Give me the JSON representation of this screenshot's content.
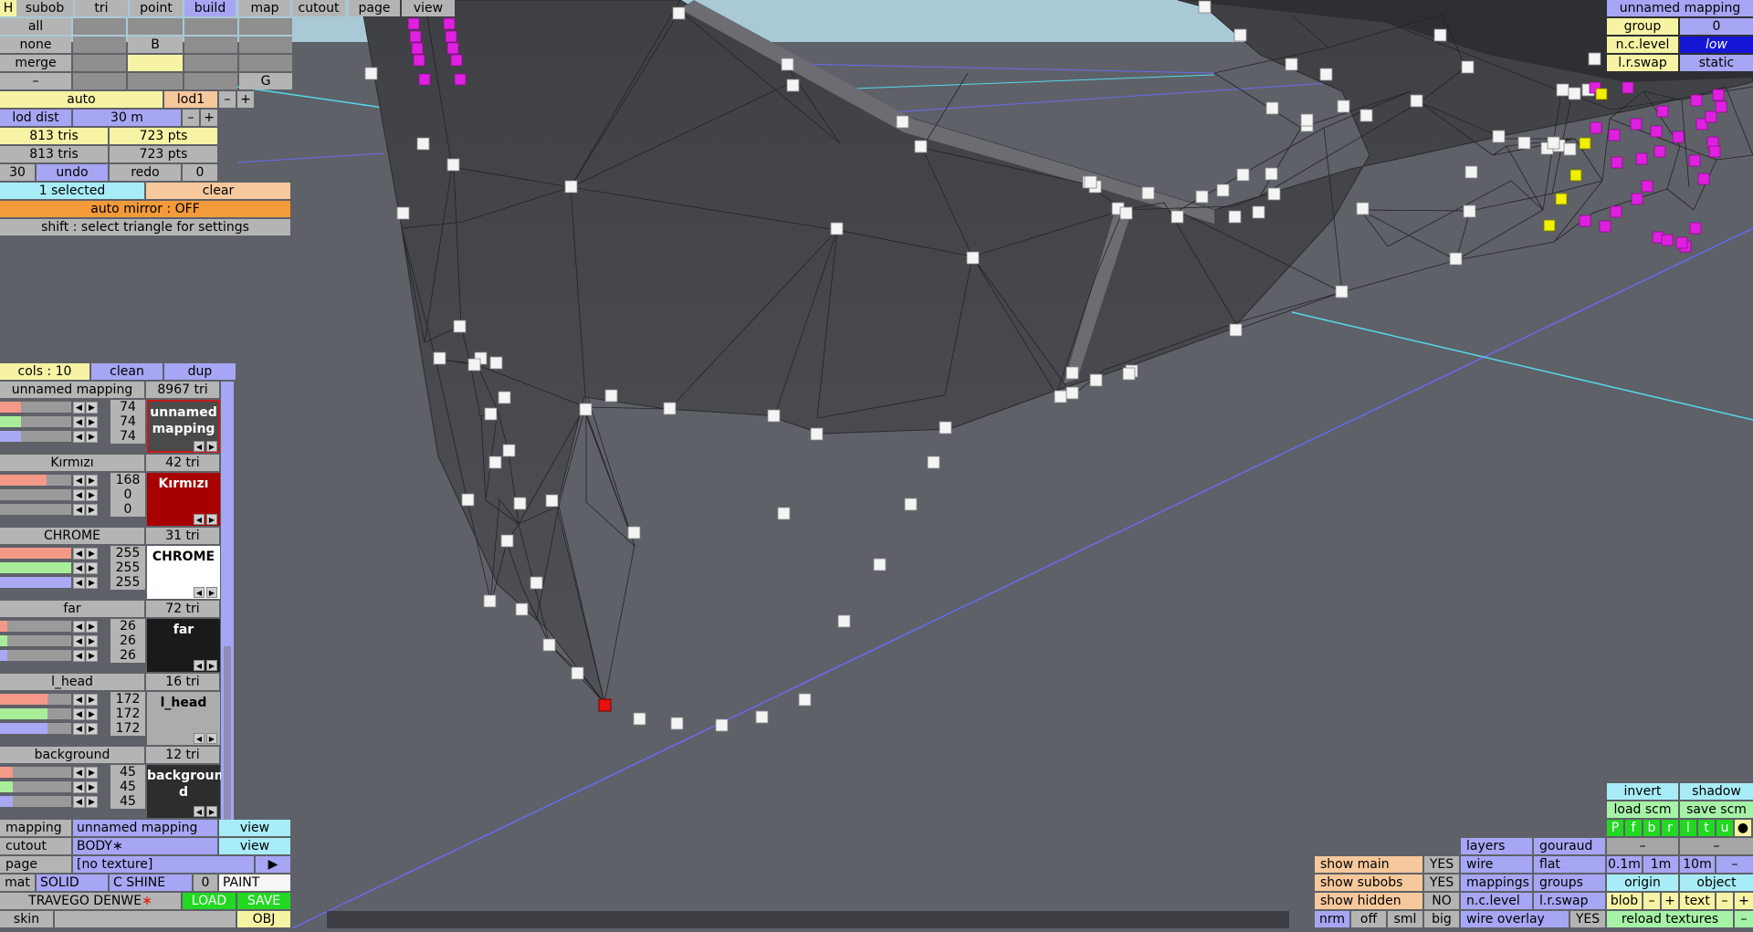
{
  "top_tabs": {
    "h": "H",
    "subob": "subob",
    "tri": "tri",
    "point": "point",
    "build": "build",
    "map": "map",
    "cutout": "cutout",
    "page": "page",
    "view": "view"
  },
  "select_menu": {
    "all": "all",
    "none": "none",
    "b": "B",
    "merge": "merge",
    "dash": "–",
    "g": "G"
  },
  "lod": {
    "auto": "auto",
    "lod1": "lod1",
    "minus": "–",
    "plus": "+",
    "lod_dist_label": "lod dist",
    "lod_dist_value": "30 m",
    "dist_minus": "–",
    "dist_plus": "+"
  },
  "stats": {
    "tris1": "813 tris",
    "pts1": "723 pts",
    "tris2": "813 tris",
    "pts2": "723 pts"
  },
  "undo": {
    "count": "30",
    "undo": "undo",
    "redo": "redo",
    "redo_count": "0"
  },
  "selection": {
    "selected": "1 selected",
    "clear": "clear",
    "mirror": "auto mirror : OFF",
    "hint": "shift : select triangle for settings"
  },
  "mappings_header": {
    "cols": "cols : 10",
    "clean": "clean",
    "dup": "dup"
  },
  "mappings": [
    {
      "name": "unnamed mapping",
      "tri": "8967 tri",
      "r": "74",
      "g": "74",
      "b": "74",
      "preview": "unnamed mapping",
      "preview_color": "#4a4a4a",
      "text_color": "#ffffff",
      "r_frac": 0.29,
      "g_frac": 0.29,
      "b_frac": 0.29
    },
    {
      "name": "Kırmızı",
      "tri": "42 tri",
      "r": "168",
      "g": "0",
      "b": "0",
      "preview": "Kırmızı",
      "preview_color": "#a80000",
      "text_color": "#ffffff",
      "r_frac": 0.66,
      "g_frac": 0.0,
      "b_frac": 0.0
    },
    {
      "name": "CHROME",
      "tri": "31 tri",
      "r": "255",
      "g": "255",
      "b": "255",
      "preview": "CHROME",
      "preview_color": "#ffffff",
      "text_color": "#000000",
      "r_frac": 1.0,
      "g_frac": 1.0,
      "b_frac": 1.0
    },
    {
      "name": "far",
      "tri": "72 tri",
      "r": "26",
      "g": "26",
      "b": "26",
      "preview": "far",
      "preview_color": "#1a1a1a",
      "text_color": "#ffffff",
      "r_frac": 0.1,
      "g_frac": 0.1,
      "b_frac": 0.1
    },
    {
      "name": "l_head",
      "tri": "16 tri",
      "r": "172",
      "g": "172",
      "b": "172",
      "preview": "l_head",
      "preview_color": "#acacac",
      "text_color": "#000000",
      "r_frac": 0.67,
      "g_frac": 0.67,
      "b_frac": 0.67
    },
    {
      "name": "background",
      "tri": "12 tri",
      "r": "45",
      "g": "45",
      "b": "45",
      "preview": "backgroun d",
      "preview_color": "#2d2d2d",
      "text_color": "#ffffff",
      "r_frac": 0.18,
      "g_frac": 0.18,
      "b_frac": 0.18
    }
  ],
  "bottom_left": {
    "mapping_label": "mapping",
    "mapping_value": "unnamed mapping",
    "view1": "view",
    "cutout_label": "cutout",
    "cutout_value": "BODY∗",
    "view2": "view",
    "page_label": "page",
    "page_value": "[no texture]",
    "page_arrow": "▶",
    "mat": "mat",
    "solid": "SOLID",
    "cshine": "C SHINE",
    "zero": "0",
    "paint": "PAINT",
    "name": "TRAVEGO DENWE",
    "name_star": "∗",
    "load": "LOAD",
    "save": "SAVE",
    "skin": "skin",
    "obj": "OBJ"
  },
  "top_right": {
    "title": "unnamed mapping",
    "group": "group",
    "group_val": "0",
    "nclevel": "n.c.level",
    "nclevel_val": "low",
    "lrswap": "l.r.swap",
    "lrswap_val": "static"
  },
  "bottom_right": {
    "invert": "invert",
    "shadow": "shadow",
    "load_scm": "load scm",
    "save_scm": "save scm",
    "letters": [
      "P",
      "f",
      "b",
      "r",
      "l",
      "t",
      "u",
      "●"
    ],
    "dash1": "–",
    "dash2": "–",
    "layers": "layers",
    "gouraud": "gouraud",
    "show_main": "show main",
    "show_main_v": "YES",
    "wire": "wire",
    "flat": "flat",
    "m01": "0.1m",
    "m1": "1m",
    "m10": "10m",
    "mdash": "–",
    "show_subobs": "show subobs",
    "show_subobs_v": "YES",
    "mappings": "mappings",
    "groups": "groups",
    "origin": "origin",
    "object": "object",
    "show_hidden": "show hidden",
    "show_hidden_v": "NO",
    "nclevel": "n.c.level",
    "lrswap": "l.r.swap",
    "blob": "blob",
    "bminus": "–",
    "bplus": "+",
    "text": "text",
    "tminus": "–",
    "tplus": "+",
    "nrm": "nrm",
    "off": "off",
    "sml": "sml",
    "big": "big",
    "wire_overlay": "wire overlay",
    "wire_overlay_v": "YES",
    "reload": "reload textures",
    "rdash": "–"
  },
  "colors": {
    "viewport_bg": "#5e6168",
    "sky": "#a9c9d6",
    "mesh": "#4a4b4e",
    "selected_vertex": "#e81010",
    "marker_magenta": "#e020e0",
    "marker_yellow": "#f0f000"
  }
}
